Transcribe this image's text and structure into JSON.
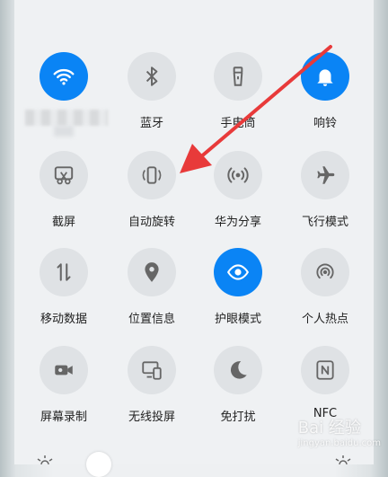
{
  "tiles": [
    {
      "name": "wlan-toggle",
      "icon": "wifi-icon",
      "label": "",
      "active": true
    },
    {
      "name": "bluetooth-toggle",
      "icon": "bluetooth-icon",
      "label": "蓝牙",
      "active": false
    },
    {
      "name": "flashlight-toggle",
      "icon": "flashlight-icon",
      "label": "手电筒",
      "active": false
    },
    {
      "name": "ringer-toggle",
      "icon": "bell-icon",
      "label": "响铃",
      "active": true
    },
    {
      "name": "screenshot-toggle",
      "icon": "scissors-icon",
      "label": "截屏",
      "active": false
    },
    {
      "name": "auto-rotate-toggle",
      "icon": "rotate-icon",
      "label": "自动旋转",
      "active": false
    },
    {
      "name": "huawei-share-toggle",
      "icon": "broadcast-icon",
      "label": "华为分享",
      "active": false
    },
    {
      "name": "airplane-mode-toggle",
      "icon": "airplane-icon",
      "label": "飞行模式",
      "active": false
    },
    {
      "name": "mobile-data-toggle",
      "icon": "data-arrows-icon",
      "label": "移动数据",
      "active": false
    },
    {
      "name": "location-toggle",
      "icon": "location-pin-icon",
      "label": "位置信息",
      "active": false
    },
    {
      "name": "eye-comfort-toggle",
      "icon": "eye-icon",
      "label": "护眼模式",
      "active": true
    },
    {
      "name": "hotspot-toggle",
      "icon": "hotspot-icon",
      "label": "个人热点",
      "active": false
    },
    {
      "name": "screen-record-toggle",
      "icon": "video-camera-icon",
      "label": "屏幕录制",
      "active": false
    },
    {
      "name": "wireless-projection-toggle",
      "icon": "cast-screen-icon",
      "label": "无线投屏",
      "active": false
    },
    {
      "name": "do-not-disturb-toggle",
      "icon": "moon-icon",
      "label": "免打扰",
      "active": false
    },
    {
      "name": "nfc-toggle",
      "icon": "nfc-icon",
      "label": "NFC",
      "active": false
    }
  ],
  "colors": {
    "active": "#0a84f5",
    "inactive": "#dfe2e5",
    "arrow": "#e83a3a"
  },
  "watermark": {
    "text": "Bai 经验",
    "sub": "jingyan.baidu.com"
  }
}
